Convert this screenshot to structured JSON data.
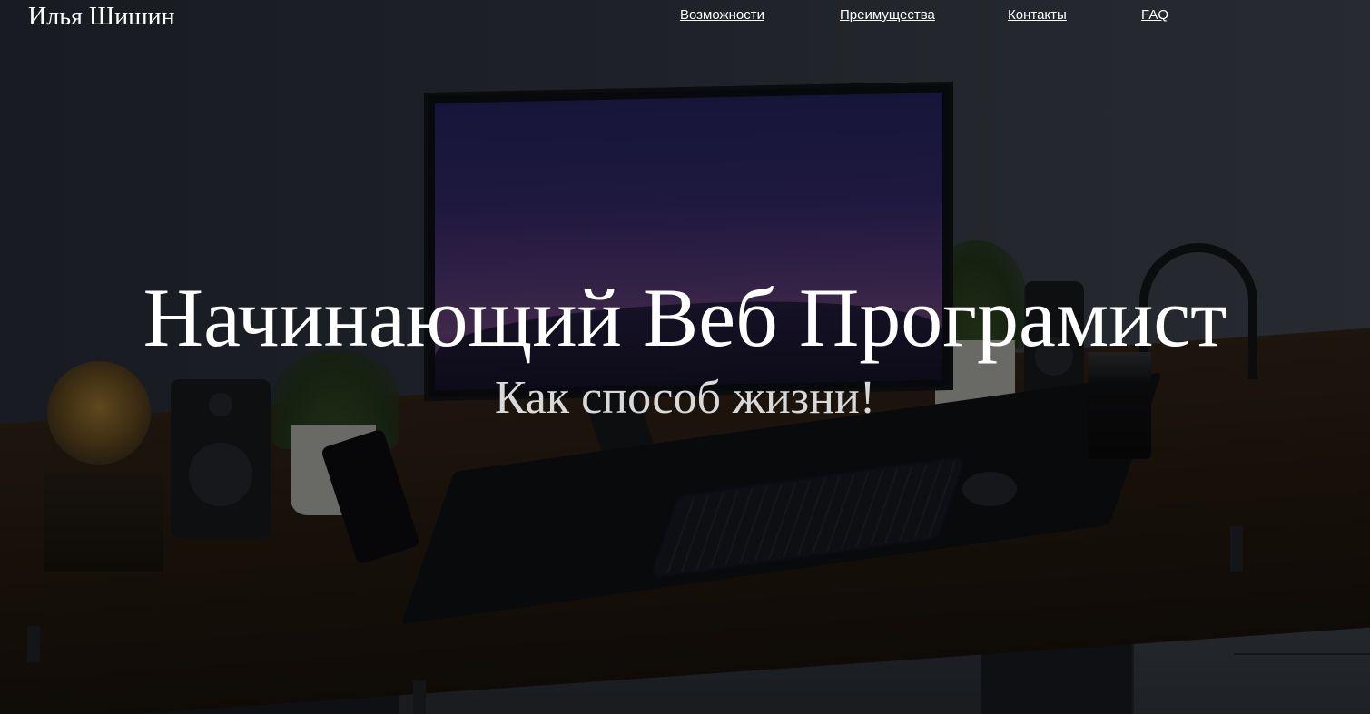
{
  "header": {
    "logo": "Илья Шишин",
    "nav": [
      {
        "label": "Возможности"
      },
      {
        "label": "Преимущества"
      },
      {
        "label": "Контакты"
      },
      {
        "label": "FAQ"
      }
    ]
  },
  "hero": {
    "title": "Начинающий Веб Програмист",
    "subtitle": "Как способ жизни!",
    "background": "desk-setup-photo"
  },
  "colors": {
    "text": "#ffffff",
    "subtitle": "#d9d9d9",
    "overlay": "#000000"
  }
}
